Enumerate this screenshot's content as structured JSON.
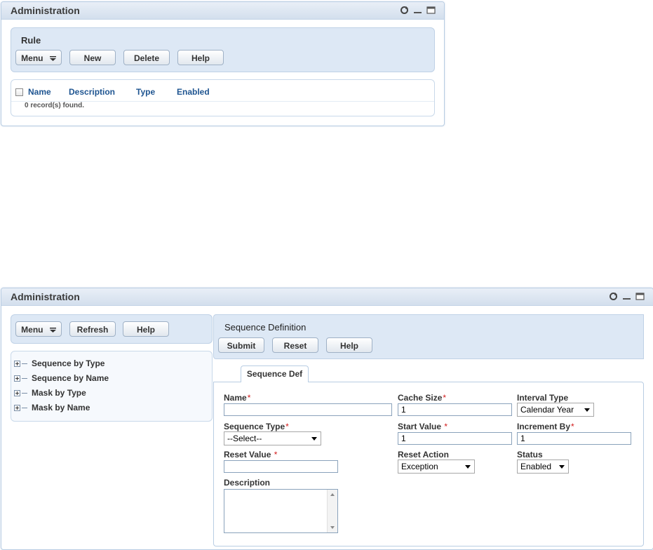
{
  "top_window": {
    "title": "Administration",
    "rule_panel": {
      "title": "Rule",
      "buttons": {
        "menu": "Menu",
        "new": "New",
        "delete": "Delete",
        "help": "Help"
      }
    },
    "table": {
      "columns": [
        "Name",
        "Description",
        "Type",
        "Enabled"
      ],
      "status": "0 record(s) found."
    }
  },
  "bottom_window": {
    "title": "Administration",
    "left_toolbar": {
      "menu": "Menu",
      "refresh": "Refresh",
      "help": "Help"
    },
    "tree": [
      "Sequence by Type",
      "Sequence by Name",
      "Mask by Type",
      "Mask by Name"
    ],
    "detail": {
      "title": "Sequence Definition",
      "buttons": {
        "submit": "Submit",
        "reset": "Reset",
        "help": "Help"
      },
      "tab": "Sequence Def",
      "form": {
        "name": {
          "label": "Name",
          "value": ""
        },
        "cache_size": {
          "label": "Cache Size",
          "value": "1"
        },
        "interval_type": {
          "label": "Interval Type",
          "value": "Calendar Year"
        },
        "sequence_type": {
          "label": "Sequence Type",
          "value": "--Select--"
        },
        "start_value": {
          "label": "Start Value",
          "value": "1"
        },
        "increment_by": {
          "label": "Increment By",
          "value": "1"
        },
        "reset_value": {
          "label": "Reset Value",
          "value": ""
        },
        "reset_action": {
          "label": "Reset Action",
          "value": "Exception"
        },
        "status": {
          "label": "Status",
          "value": "Enabled"
        },
        "description": {
          "label": "Description",
          "value": ""
        }
      },
      "required_mark": "*"
    }
  },
  "colors": {
    "accent_text": "#1f5591",
    "panel_bg": "#dde8f5",
    "required": "#d21a1a"
  },
  "icons": [
    "refresh-icon",
    "minimize-icon",
    "maximize-icon",
    "menu-dropdown-icon",
    "expand-icon"
  ]
}
